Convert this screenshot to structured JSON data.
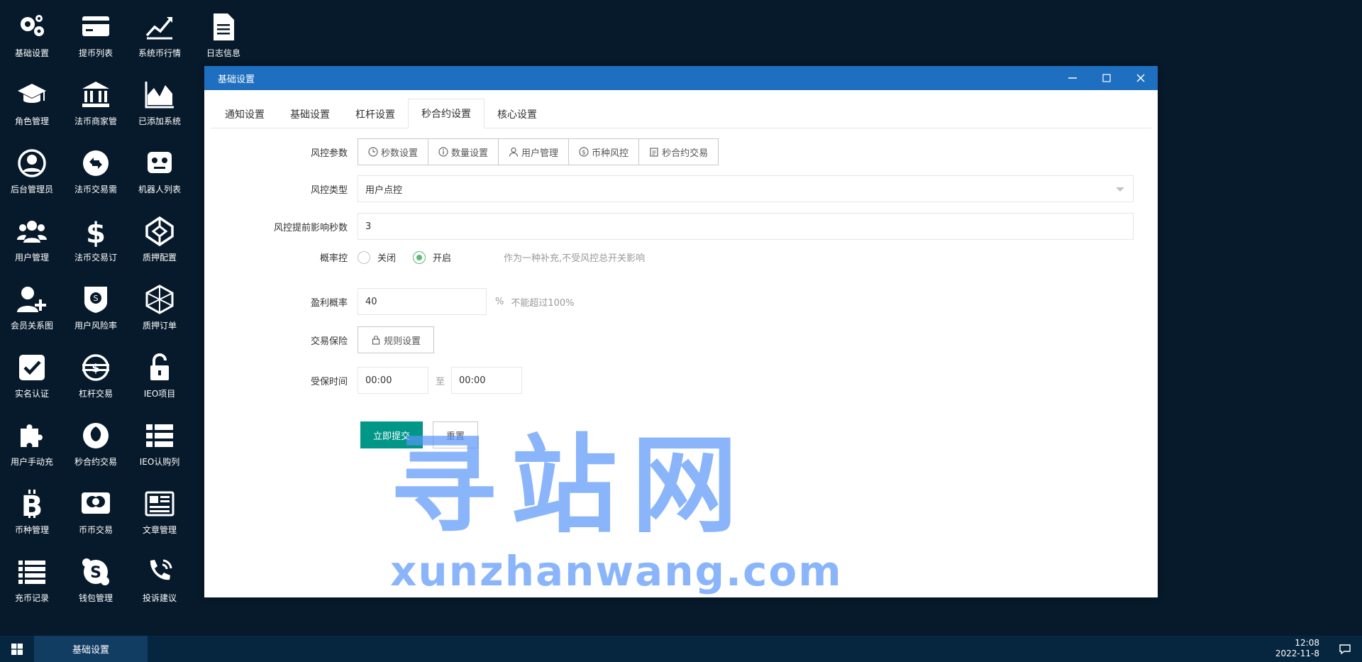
{
  "desktop_icons": [
    {
      "label": "基础设置",
      "icon": "gears-icon"
    },
    {
      "label": "提币列表",
      "icon": "credit-card-icon"
    },
    {
      "label": "系统币行情",
      "icon": "line-chart-icon"
    },
    {
      "label": "日志信息",
      "icon": "document-icon"
    },
    {
      "label": "角色管理",
      "icon": "graduation-cap-icon"
    },
    {
      "label": "法币商家管",
      "icon": "bank-icon"
    },
    {
      "label": "已添加系统",
      "icon": "area-chart-icon"
    },
    {
      "label": "后台管理员",
      "icon": "user-circle-icon"
    },
    {
      "label": "法币交易需",
      "icon": "exchange-icon"
    },
    {
      "label": "机器人列表",
      "icon": "robot-icon"
    },
    {
      "label": "用户管理",
      "icon": "users-icon"
    },
    {
      "label": "法币交易订",
      "icon": "dollar-icon"
    },
    {
      "label": "质押配置",
      "icon": "codepen-icon"
    },
    {
      "label": "会员关系图",
      "icon": "user-plus-icon"
    },
    {
      "label": "用户风险率",
      "icon": "shield-coin-icon"
    },
    {
      "label": "质押订单",
      "icon": "polyhedron-icon"
    },
    {
      "label": "实名认证",
      "icon": "check-square-icon"
    },
    {
      "label": "杠杆交易",
      "icon": "globe-coin-icon"
    },
    {
      "label": "IEO项目",
      "icon": "unlock-icon"
    },
    {
      "label": "用户手动充",
      "icon": "puzzle-icon"
    },
    {
      "label": "秒合约交易",
      "icon": "rebel-icon"
    },
    {
      "label": "IEO认购列",
      "icon": "list-icon"
    },
    {
      "label": "币种管理",
      "icon": "bitcoin-icon"
    },
    {
      "label": "币币交易",
      "icon": "mastercard-icon"
    },
    {
      "label": "文章管理",
      "icon": "newspaper-icon"
    },
    {
      "label": "充币记录",
      "icon": "list-lines-icon"
    },
    {
      "label": "钱包管理",
      "icon": "skype-icon"
    },
    {
      "label": "投诉建议",
      "icon": "phone-icon"
    }
  ],
  "window": {
    "title": "基础设置",
    "tabs": [
      "通知设置",
      "基础设置",
      "杠杆设置",
      "秒合约设置",
      "核心设置"
    ],
    "active_tab": "秒合约设置"
  },
  "form": {
    "risk_params_label": "风控参数",
    "risk_buttons": [
      {
        "label": "秒数设置",
        "icon": "clock-icon"
      },
      {
        "label": "数量设置",
        "icon": "info-icon"
      },
      {
        "label": "用户管理",
        "icon": "user-icon"
      },
      {
        "label": "币种风控",
        "icon": "coin-icon"
      },
      {
        "label": "秒合约交易",
        "icon": "clipboard-icon"
      }
    ],
    "risk_type_label": "风控类型",
    "risk_type_value": "用户点控",
    "advance_seconds_label": "风控提前影响秒数",
    "advance_seconds_value": "3",
    "prob_control_label": "概率控",
    "prob_off": "关闭",
    "prob_on": "开启",
    "prob_selected": "开启",
    "prob_hint": "作为一种补充,不受风控总开关影响",
    "profit_prob_label": "盈利概率",
    "profit_prob_value": "40",
    "profit_prob_unit": "%",
    "profit_prob_hint": "不能超过100%",
    "insurance_label": "交易保险",
    "insurance_button": "规则设置",
    "protect_time_label": "受保时间",
    "protect_time_from": "00:00",
    "protect_time_sep": "至",
    "protect_time_to": "00:00",
    "submit": "立即提交",
    "reset": "重置"
  },
  "watermark": {
    "big": "寻站网",
    "small": "xunzhanwang.com"
  },
  "taskbar": {
    "task": "基础设置",
    "time": "12:08",
    "date": "2022-11-8"
  }
}
